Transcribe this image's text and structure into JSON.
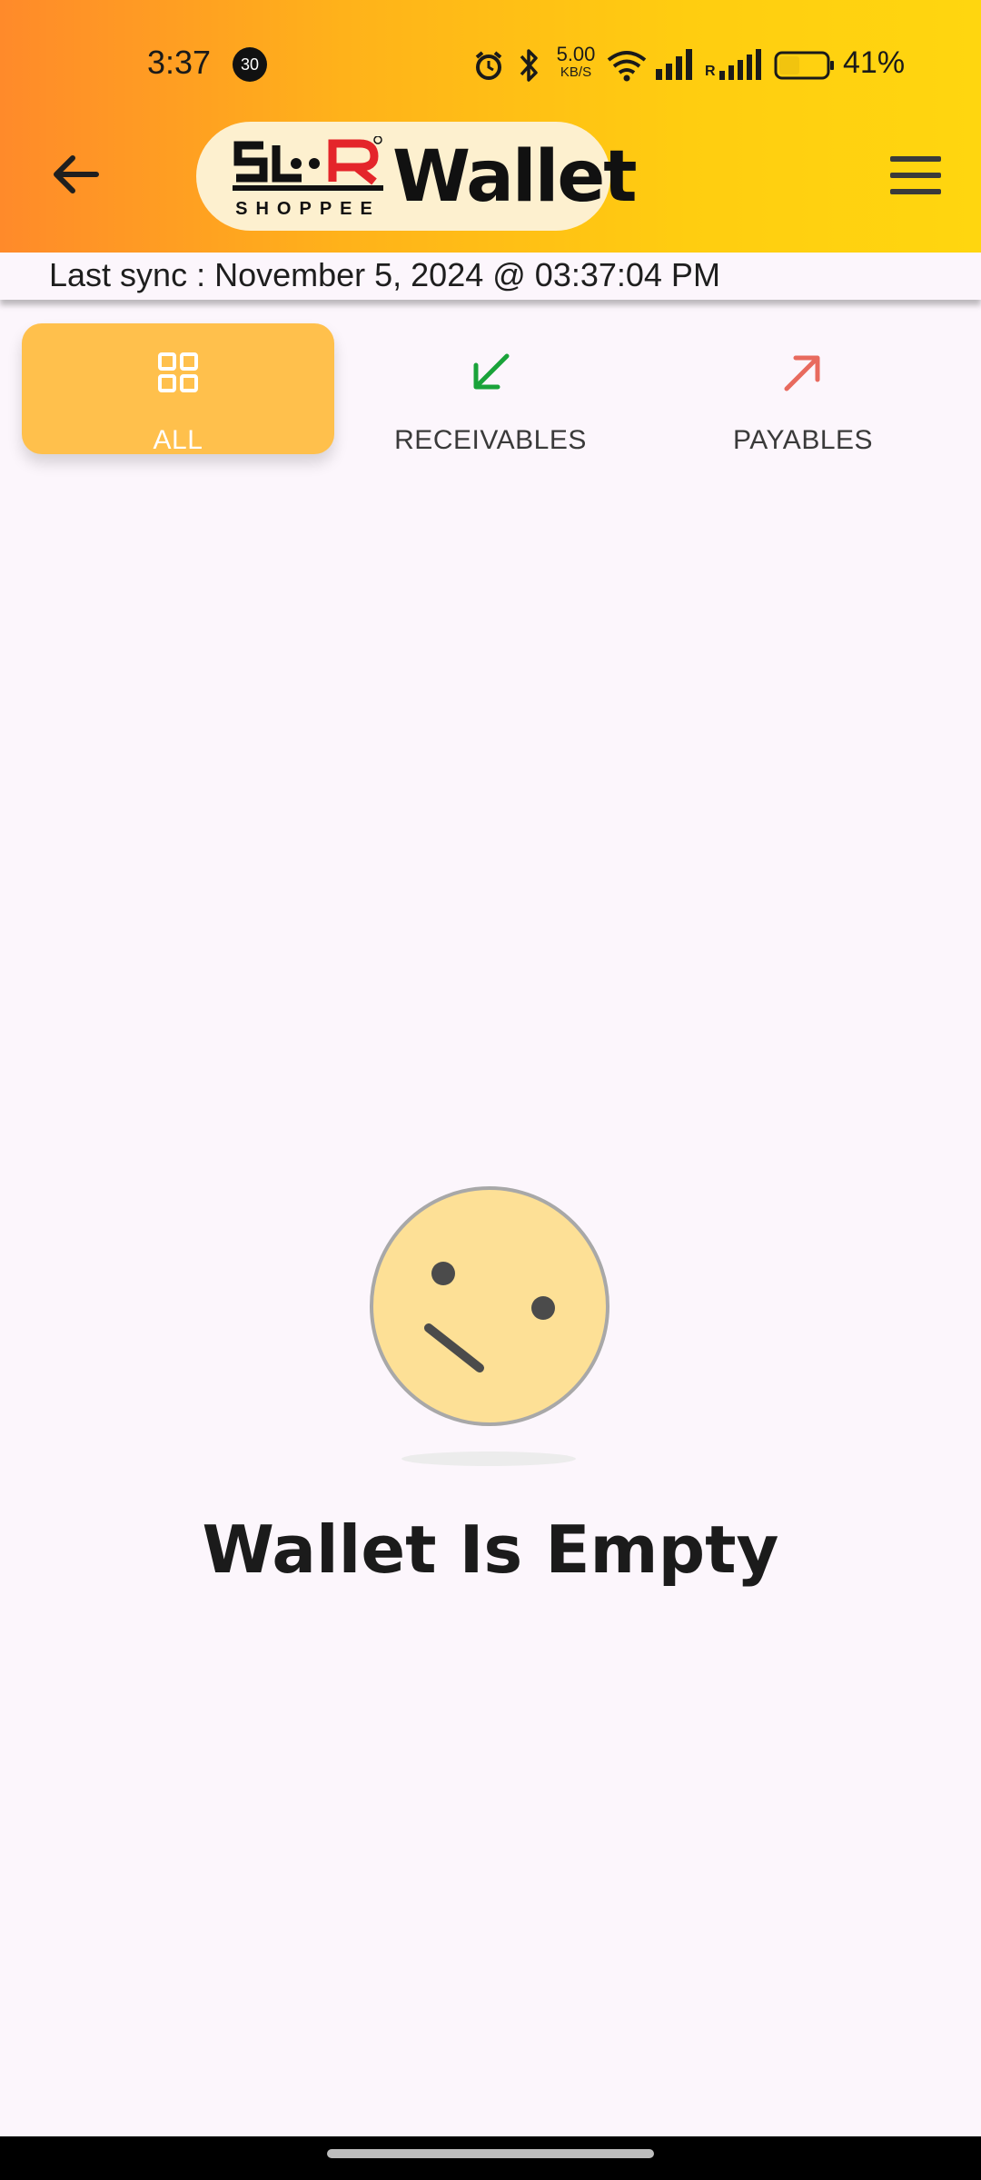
{
  "status_bar": {
    "time": "3:37",
    "notification_count": "30",
    "net_speed_value": "5.00",
    "net_speed_unit": "KB/S",
    "battery_percent": "41%",
    "sim_label": "R"
  },
  "header": {
    "logo_brand": "SLR",
    "logo_sub": "SHOPPEE",
    "logo_word": "Wallet",
    "back_icon": "arrow-left-icon",
    "menu_icon": "hamburger-menu-icon"
  },
  "sync": {
    "text": "Last sync : November 5, 2024 @ 03:37:04 PM"
  },
  "tabs": [
    {
      "label": "ALL",
      "icon": "grid-icon",
      "active": true
    },
    {
      "label": "RECEIVABLES",
      "icon": "arrow-down-left-icon",
      "active": false
    },
    {
      "label": "PAYABLES",
      "icon": "arrow-up-right-icon",
      "active": false
    }
  ],
  "empty_state": {
    "icon": "confused-face-icon",
    "title": "Wallet Is Empty"
  },
  "colors": {
    "header_gradient_start": "#ff8a2a",
    "header_gradient_end": "#ffd60f",
    "active_tab": "#ffc04c",
    "receivables_green": "#1aa33a",
    "payables_red": "#e86a5e",
    "face_fill": "#fde096"
  }
}
